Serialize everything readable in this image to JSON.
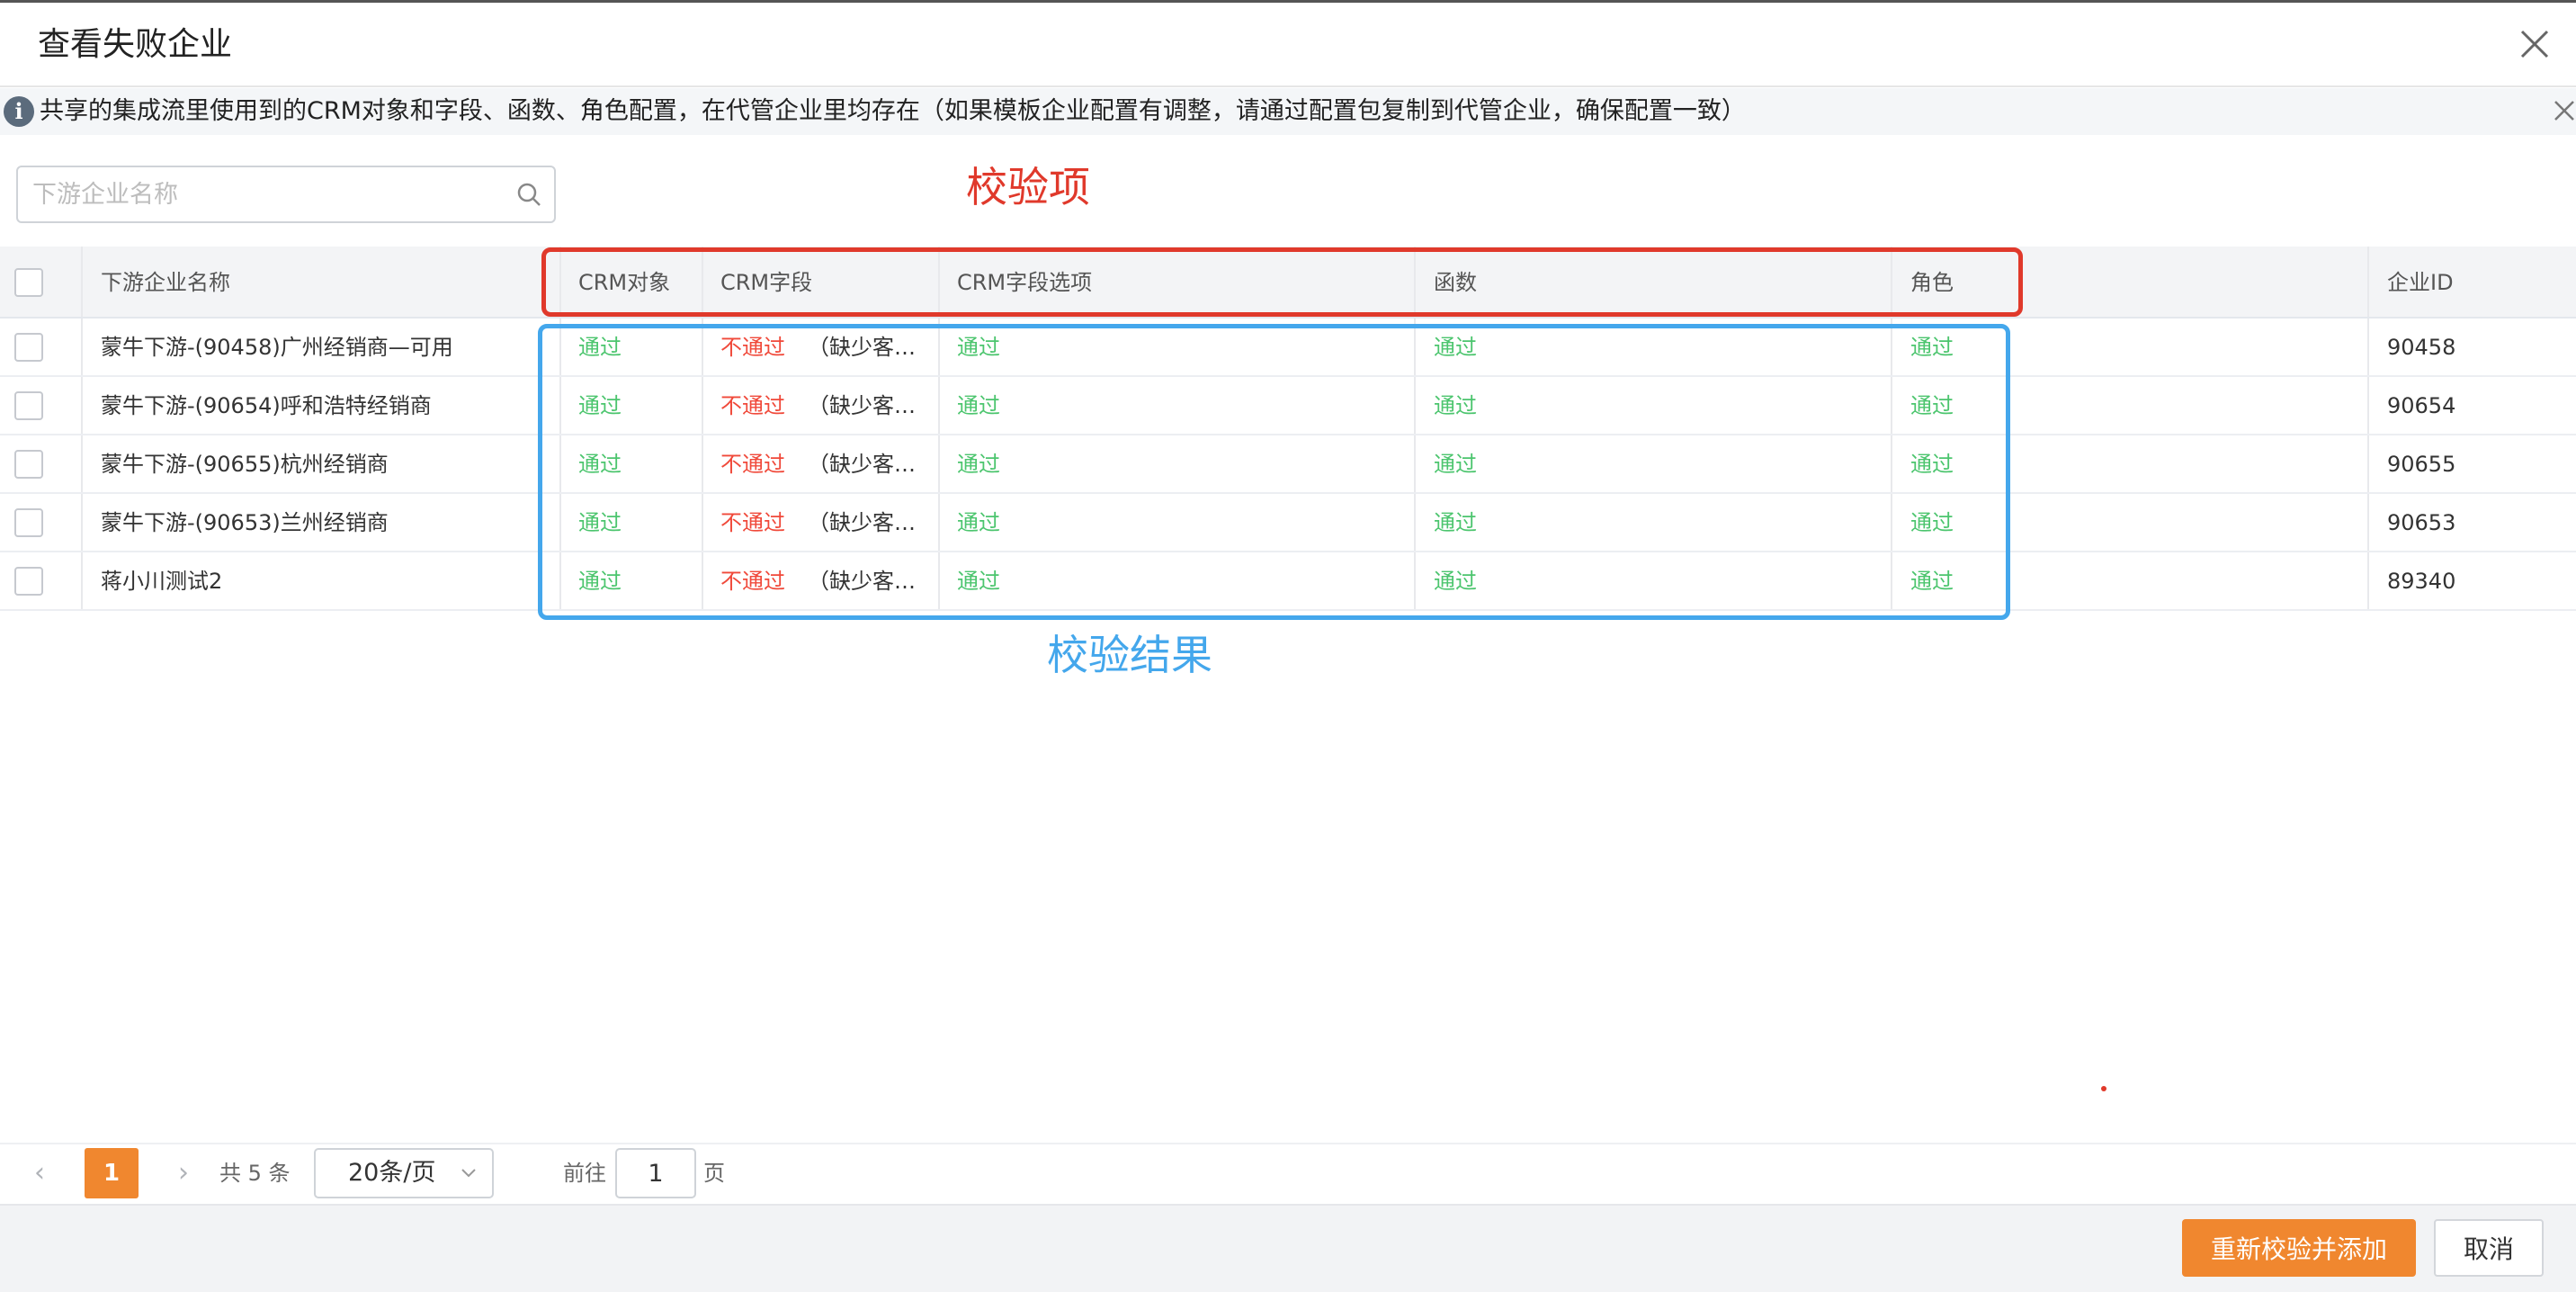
{
  "dialog": {
    "title": "查看失败企业"
  },
  "notice": {
    "icon": "info-icon",
    "text": "共享的集成流里使用到的CRM对象和字段、函数、角色配置，在代管企业里均存在（如果模板企业配置有调整，请通过配置包复制到代管企业，确保配置一致）"
  },
  "search": {
    "placeholder": "下游企业名称"
  },
  "annotations": {
    "check_items": "校验项",
    "check_results": "校验结果",
    "colors": {
      "red": "#e0392b",
      "blue": "#44a7ec"
    }
  },
  "table": {
    "columns": {
      "name": "下游企业名称",
      "crm_object": "CRM对象",
      "crm_field": "CRM字段",
      "crm_field_option": "CRM字段选项",
      "function": "函数",
      "role": "角色",
      "tenant_id": "企业ID"
    },
    "rows": [
      {
        "name": "蒙牛下游-(90458)广州经销商—可用",
        "crm_object": "通过",
        "crm_field": "不通过",
        "crm_field_detail": "（缺少客…",
        "crm_field_option": "通过",
        "function": "通过",
        "role": "通过",
        "tenant_id": "90458"
      },
      {
        "name": "蒙牛下游-(90654)呼和浩特经销商",
        "crm_object": "通过",
        "crm_field": "不通过",
        "crm_field_detail": "（缺少客…",
        "crm_field_option": "通过",
        "function": "通过",
        "role": "通过",
        "tenant_id": "90654"
      },
      {
        "name": "蒙牛下游-(90655)杭州经销商",
        "crm_object": "通过",
        "crm_field": "不通过",
        "crm_field_detail": "（缺少客…",
        "crm_field_option": "通过",
        "function": "通过",
        "role": "通过",
        "tenant_id": "90655"
      },
      {
        "name": "蒙牛下游-(90653)兰州经销商",
        "crm_object": "通过",
        "crm_field": "不通过",
        "crm_field_detail": "（缺少客…",
        "crm_field_option": "通过",
        "function": "通过",
        "role": "通过",
        "tenant_id": "90653"
      },
      {
        "name": "蒋小川测试2",
        "crm_object": "通过",
        "crm_field": "不通过",
        "crm_field_detail": "（缺少客…",
        "crm_field_option": "通过",
        "function": "通过",
        "role": "通过",
        "tenant_id": "89340"
      }
    ],
    "status_colors": {
      "pass": "#4cc56e",
      "fail": "#f0493a"
    }
  },
  "pagination": {
    "prev": "‹",
    "next": "›",
    "current_page": "1",
    "total": "共 5 条",
    "page_size": "20条/页",
    "goto_label": "前往",
    "goto_value": "1",
    "page_suffix": "页",
    "accent": "#f0872f"
  },
  "footer": {
    "primary_button": "重新校验并添加",
    "cancel_button": "取消"
  }
}
